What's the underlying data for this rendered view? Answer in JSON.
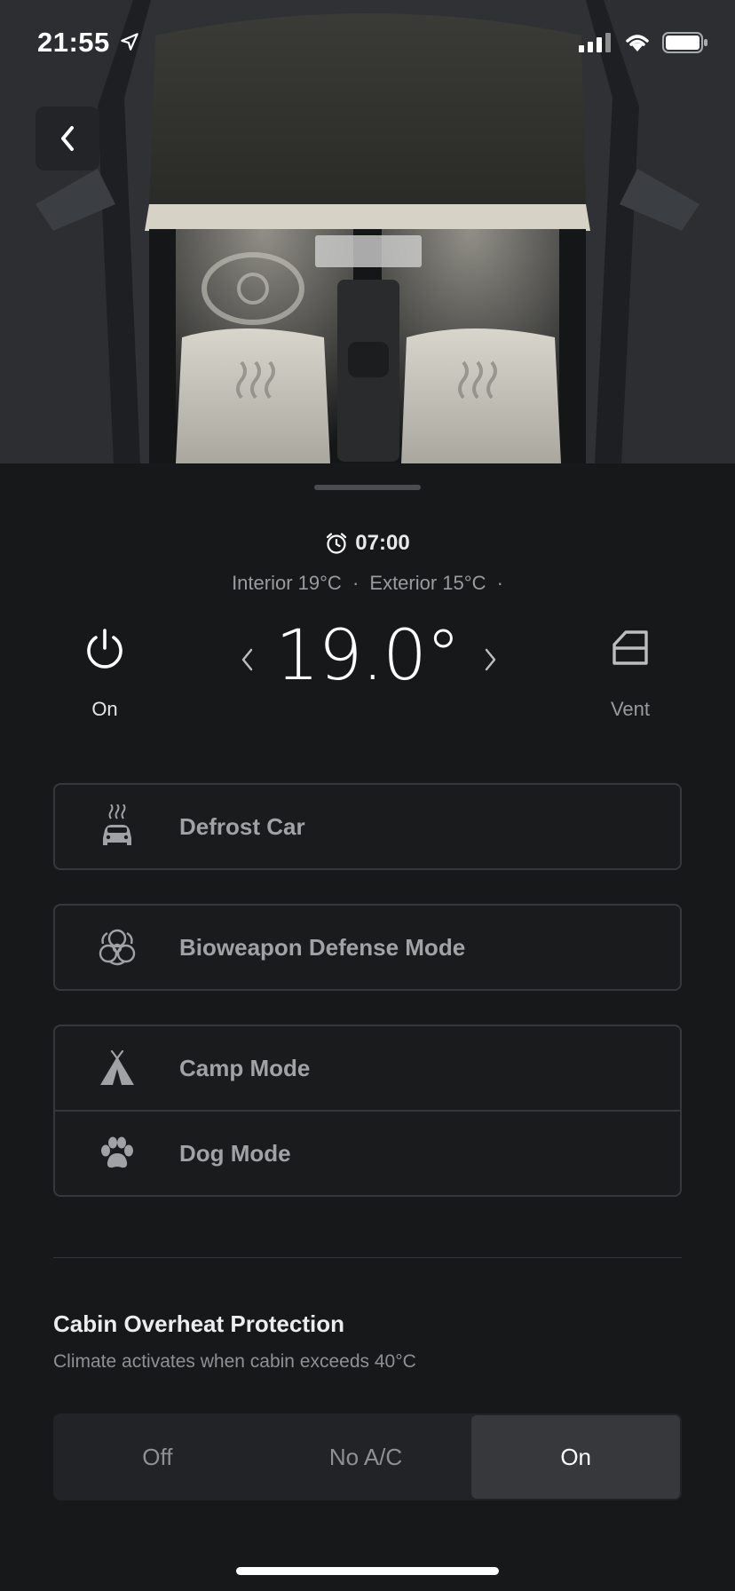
{
  "status_bar": {
    "time": "21:55"
  },
  "schedule": {
    "time": "07:00"
  },
  "temps": {
    "interior": "Interior 19°C",
    "separator": "·",
    "exterior": "Exterior 15°C",
    "trailing": "·"
  },
  "climate": {
    "power_label": "On",
    "temperature": "19.0°",
    "vent_label": "Vent"
  },
  "modes": {
    "defrost": "Defrost Car",
    "bioweapon": "Bioweapon Defense Mode",
    "camp": "Camp Mode",
    "dog": "Dog Mode"
  },
  "overheat": {
    "title": "Cabin Overheat Protection",
    "subtitle": "Climate activates when cabin exceeds 40°C",
    "options": [
      "Off",
      "No A/C",
      "On"
    ],
    "selected": "On"
  }
}
